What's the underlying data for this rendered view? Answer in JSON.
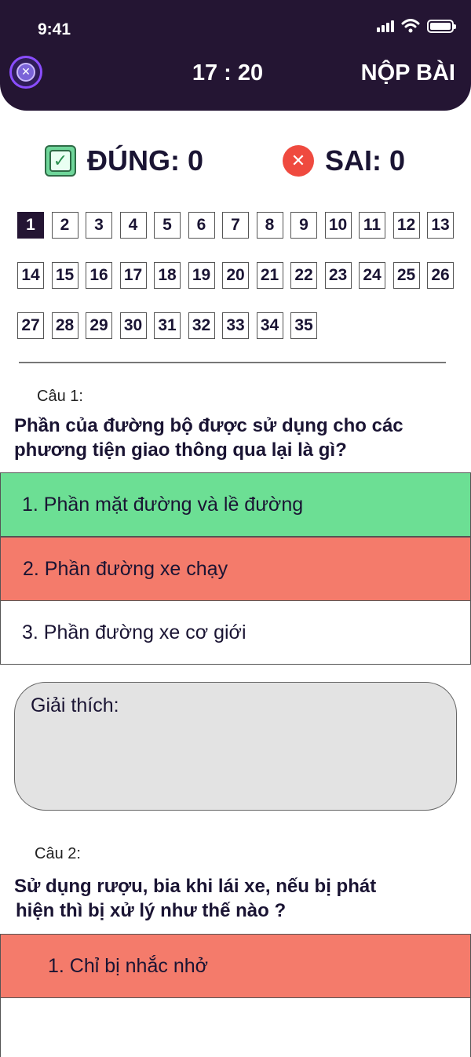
{
  "status_bar": {
    "time": "9:41"
  },
  "header": {
    "timer": "17 : 20",
    "submit_label": "NỘP BÀI"
  },
  "score": {
    "correct_label": "ĐÚNG: 0",
    "wrong_label": "SAI: 0",
    "check_glyph": "✓",
    "x_glyph": "✕"
  },
  "question_grid": {
    "active": 1,
    "numbers": [
      "1",
      "2",
      "3",
      "4",
      "5",
      "6",
      "7",
      "8",
      "9",
      "10",
      "11",
      "12",
      "13",
      "14",
      "15",
      "16",
      "17",
      "18",
      "19",
      "20",
      "21",
      "22",
      "23",
      "24",
      "25",
      "26",
      "27",
      "28",
      "29",
      "30",
      "31",
      "32",
      "33",
      "34",
      "35"
    ]
  },
  "q1": {
    "label": "Câu 1:",
    "text": "Phần của đường bộ được sử dụng cho các phương tiện giao thông qua lại là gì?",
    "answers": [
      {
        "text": "1. Phần mặt đường và lề đường",
        "state": "correct"
      },
      {
        "text": "2. Phần đường xe chạy",
        "state": "wrong"
      },
      {
        "text": "3. Phần đường xe cơ giới",
        "state": "neutral"
      }
    ]
  },
  "explanation": {
    "label": "Giải thích:"
  },
  "q2": {
    "label": "Câu 2:",
    "text_line1": "Sử dụng rượu, bia khi lái xe, nếu bị phát",
    "text_line2": "hiện thì bị xử lý như thế nào ?",
    "answers": [
      {
        "text": "1. Chỉ bị nhắc nhở",
        "state": "wrong"
      },
      {
        "text": "",
        "state": "neutral"
      }
    ]
  },
  "colors": {
    "header_bg": "#241533",
    "correct": "#6cdf94",
    "wrong": "#f47b6b",
    "explain_bg": "#e3e3e3"
  },
  "icons": [
    "close-icon",
    "check-icon",
    "x-icon",
    "signal-icon",
    "wifi-icon",
    "battery-icon"
  ]
}
